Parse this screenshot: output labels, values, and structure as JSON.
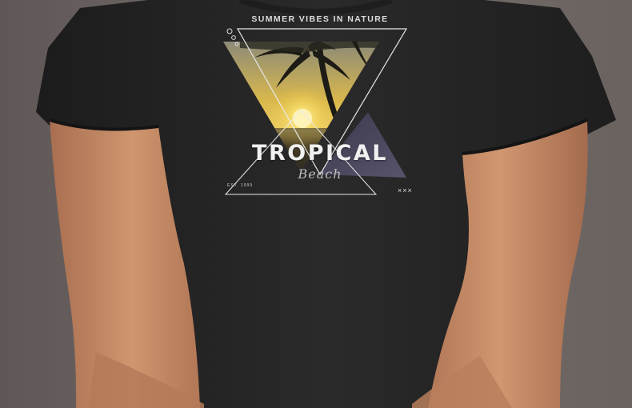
{
  "graphic": {
    "tagline": "SUMMER VIBES IN NATURE",
    "title": "TROPICAL",
    "script": "Beach",
    "est": "EST. 1999",
    "marks": "×××"
  },
  "colors": {
    "background": "#6e6563",
    "shirt": "#262626",
    "skin": "#c48a66",
    "sunset": "#e8c64a",
    "dusk": "#4d4a66"
  }
}
